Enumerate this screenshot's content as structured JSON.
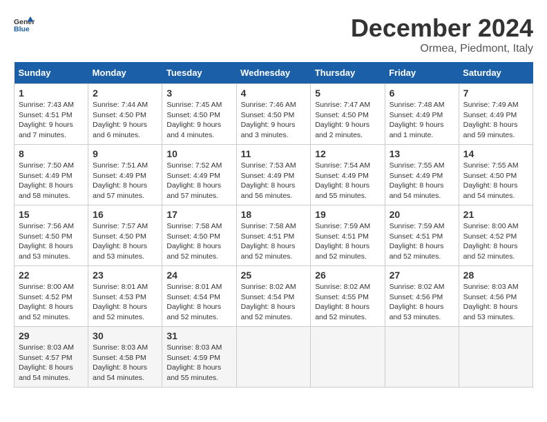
{
  "header": {
    "logo_general": "General",
    "logo_blue": "Blue",
    "month_title": "December 2024",
    "location": "Ormea, Piedmont, Italy"
  },
  "weekdays": [
    "Sunday",
    "Monday",
    "Tuesday",
    "Wednesday",
    "Thursday",
    "Friday",
    "Saturday"
  ],
  "days": [
    {
      "date": "1",
      "sunrise": "Sunrise: 7:43 AM",
      "sunset": "Sunset: 4:51 PM",
      "daylight": "Daylight: 9 hours and 7 minutes."
    },
    {
      "date": "2",
      "sunrise": "Sunrise: 7:44 AM",
      "sunset": "Sunset: 4:50 PM",
      "daylight": "Daylight: 9 hours and 6 minutes."
    },
    {
      "date": "3",
      "sunrise": "Sunrise: 7:45 AM",
      "sunset": "Sunset: 4:50 PM",
      "daylight": "Daylight: 9 hours and 4 minutes."
    },
    {
      "date": "4",
      "sunrise": "Sunrise: 7:46 AM",
      "sunset": "Sunset: 4:50 PM",
      "daylight": "Daylight: 9 hours and 3 minutes."
    },
    {
      "date": "5",
      "sunrise": "Sunrise: 7:47 AM",
      "sunset": "Sunset: 4:50 PM",
      "daylight": "Daylight: 9 hours and 2 minutes."
    },
    {
      "date": "6",
      "sunrise": "Sunrise: 7:48 AM",
      "sunset": "Sunset: 4:49 PM",
      "daylight": "Daylight: 9 hours and 1 minute."
    },
    {
      "date": "7",
      "sunrise": "Sunrise: 7:49 AM",
      "sunset": "Sunset: 4:49 PM",
      "daylight": "Daylight: 8 hours and 59 minutes."
    },
    {
      "date": "8",
      "sunrise": "Sunrise: 7:50 AM",
      "sunset": "Sunset: 4:49 PM",
      "daylight": "Daylight: 8 hours and 58 minutes."
    },
    {
      "date": "9",
      "sunrise": "Sunrise: 7:51 AM",
      "sunset": "Sunset: 4:49 PM",
      "daylight": "Daylight: 8 hours and 57 minutes."
    },
    {
      "date": "10",
      "sunrise": "Sunrise: 7:52 AM",
      "sunset": "Sunset: 4:49 PM",
      "daylight": "Daylight: 8 hours and 57 minutes."
    },
    {
      "date": "11",
      "sunrise": "Sunrise: 7:53 AM",
      "sunset": "Sunset: 4:49 PM",
      "daylight": "Daylight: 8 hours and 56 minutes."
    },
    {
      "date": "12",
      "sunrise": "Sunrise: 7:54 AM",
      "sunset": "Sunset: 4:49 PM",
      "daylight": "Daylight: 8 hours and 55 minutes."
    },
    {
      "date": "13",
      "sunrise": "Sunrise: 7:55 AM",
      "sunset": "Sunset: 4:49 PM",
      "daylight": "Daylight: 8 hours and 54 minutes."
    },
    {
      "date": "14",
      "sunrise": "Sunrise: 7:55 AM",
      "sunset": "Sunset: 4:50 PM",
      "daylight": "Daylight: 8 hours and 54 minutes."
    },
    {
      "date": "15",
      "sunrise": "Sunrise: 7:56 AM",
      "sunset": "Sunset: 4:50 PM",
      "daylight": "Daylight: 8 hours and 53 minutes."
    },
    {
      "date": "16",
      "sunrise": "Sunrise: 7:57 AM",
      "sunset": "Sunset: 4:50 PM",
      "daylight": "Daylight: 8 hours and 53 minutes."
    },
    {
      "date": "17",
      "sunrise": "Sunrise: 7:58 AM",
      "sunset": "Sunset: 4:50 PM",
      "daylight": "Daylight: 8 hours and 52 minutes."
    },
    {
      "date": "18",
      "sunrise": "Sunrise: 7:58 AM",
      "sunset": "Sunset: 4:51 PM",
      "daylight": "Daylight: 8 hours and 52 minutes."
    },
    {
      "date": "19",
      "sunrise": "Sunrise: 7:59 AM",
      "sunset": "Sunset: 4:51 PM",
      "daylight": "Daylight: 8 hours and 52 minutes."
    },
    {
      "date": "20",
      "sunrise": "Sunrise: 7:59 AM",
      "sunset": "Sunset: 4:51 PM",
      "daylight": "Daylight: 8 hours and 52 minutes."
    },
    {
      "date": "21",
      "sunrise": "Sunrise: 8:00 AM",
      "sunset": "Sunset: 4:52 PM",
      "daylight": "Daylight: 8 hours and 52 minutes."
    },
    {
      "date": "22",
      "sunrise": "Sunrise: 8:00 AM",
      "sunset": "Sunset: 4:52 PM",
      "daylight": "Daylight: 8 hours and 52 minutes."
    },
    {
      "date": "23",
      "sunrise": "Sunrise: 8:01 AM",
      "sunset": "Sunset: 4:53 PM",
      "daylight": "Daylight: 8 hours and 52 minutes."
    },
    {
      "date": "24",
      "sunrise": "Sunrise: 8:01 AM",
      "sunset": "Sunset: 4:54 PM",
      "daylight": "Daylight: 8 hours and 52 minutes."
    },
    {
      "date": "25",
      "sunrise": "Sunrise: 8:02 AM",
      "sunset": "Sunset: 4:54 PM",
      "daylight": "Daylight: 8 hours and 52 minutes."
    },
    {
      "date": "26",
      "sunrise": "Sunrise: 8:02 AM",
      "sunset": "Sunset: 4:55 PM",
      "daylight": "Daylight: 8 hours and 52 minutes."
    },
    {
      "date": "27",
      "sunrise": "Sunrise: 8:02 AM",
      "sunset": "Sunset: 4:56 PM",
      "daylight": "Daylight: 8 hours and 53 minutes."
    },
    {
      "date": "28",
      "sunrise": "Sunrise: 8:03 AM",
      "sunset": "Sunset: 4:56 PM",
      "daylight": "Daylight: 8 hours and 53 minutes."
    },
    {
      "date": "29",
      "sunrise": "Sunrise: 8:03 AM",
      "sunset": "Sunset: 4:57 PM",
      "daylight": "Daylight: 8 hours and 54 minutes."
    },
    {
      "date": "30",
      "sunrise": "Sunrise: 8:03 AM",
      "sunset": "Sunset: 4:58 PM",
      "daylight": "Daylight: 8 hours and 54 minutes."
    },
    {
      "date": "31",
      "sunrise": "Sunrise: 8:03 AM",
      "sunset": "Sunset: 4:59 PM",
      "daylight": "Daylight: 8 hours and 55 minutes."
    }
  ]
}
